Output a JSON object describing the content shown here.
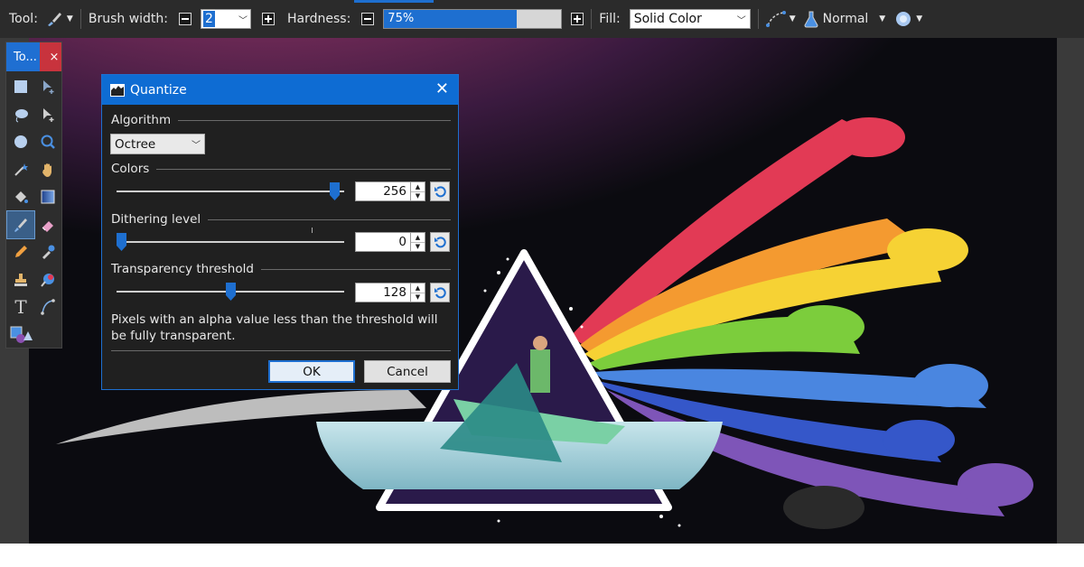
{
  "toolbar": {
    "tool_label": "Tool:",
    "brush_width_label": "Brush width:",
    "brush_width_value": "2",
    "hardness_label": "Hardness:",
    "hardness_value": "75%",
    "hardness_fraction": 0.75,
    "fill_label": "Fill:",
    "fill_value": "Solid Color",
    "blend_mode": "Normal",
    "icons": [
      "brush-icon",
      "minus-icon",
      "plus-icon",
      "line-curve-icon",
      "flask-icon",
      "gear-flower-icon"
    ]
  },
  "tools_panel": {
    "title": "To...",
    "close_label": "×",
    "tools": [
      "rectangle-select-icon",
      "move-selection-icon",
      "lasso-select-icon",
      "move-selected-icon",
      "ellipse-select-icon",
      "zoom-icon",
      "magic-wand-icon",
      "pan-icon",
      "paint-bucket-icon",
      "gradient-icon",
      "paintbrush-icon",
      "eraser-icon",
      "pencil-icon",
      "color-picker-icon",
      "clone-stamp-icon",
      "recolor-icon",
      "text-icon",
      "line-curve-icon",
      "shapes-icon"
    ]
  },
  "dialog": {
    "title": "Quantize",
    "close_label": "✕",
    "algorithm_label": "Algorithm",
    "algorithm_value": "Octree",
    "colors_label": "Colors",
    "colors_value": "256",
    "colors_fraction": 0.98,
    "dithering_label": "Dithering level",
    "dithering_value": "0",
    "dithering_fraction": 0.0,
    "transparency_label": "Transparency threshold",
    "transparency_value": "128",
    "transparency_fraction": 0.5,
    "description": "Pixels with an alpha value less than the threshold will be fully transparent.",
    "ok_label": "OK",
    "cancel_label": "Cancel"
  },
  "colors": {
    "accent": "#1e6fd0",
    "toolbar_bg": "#2b2b2b",
    "dialog_bg": "#202020",
    "close_red": "#c8333d"
  }
}
